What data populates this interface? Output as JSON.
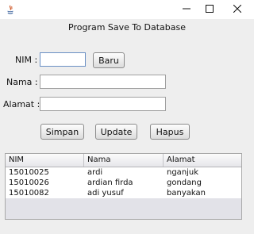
{
  "heading": "Program Save  To Database",
  "form": {
    "nim_label": "NIM :",
    "nama_label": "Nama :",
    "alamat_label": "Alamat :",
    "nim_value": "",
    "nama_value": "",
    "alamat_value": ""
  },
  "buttons": {
    "baru": "Baru",
    "simpan": "Simpan",
    "update": "Update",
    "hapus": "Hapus"
  },
  "table": {
    "columns": [
      "NIM",
      "Nama",
      "Alamat"
    ],
    "rows": [
      [
        "15010025",
        "ardi",
        "nganjuk"
      ],
      [
        "15010026",
        "ardian firda",
        "gondang"
      ],
      [
        "15010082",
        "adi yusuf",
        "banyakan"
      ]
    ]
  }
}
